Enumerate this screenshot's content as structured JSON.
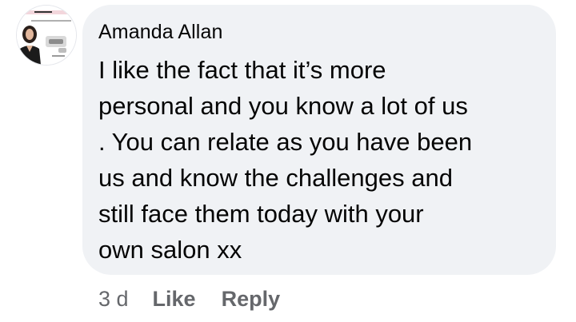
{
  "comment": {
    "author": "Amanda Allan",
    "avatar_icon": "profile-photo",
    "text_lines": [
      "I like the fact that it’s more",
      "personal and you know a lot of us",
      ". You can relate as you have been",
      "us and know the challenges and",
      "still face them today with your",
      "own salon xx"
    ],
    "timestamp": "3 d",
    "like_label": "Like",
    "reply_label": "Reply"
  },
  "colors": {
    "bubble_bg": "#f0f2f5",
    "text": "#050505",
    "secondary_text": "#65676b"
  }
}
